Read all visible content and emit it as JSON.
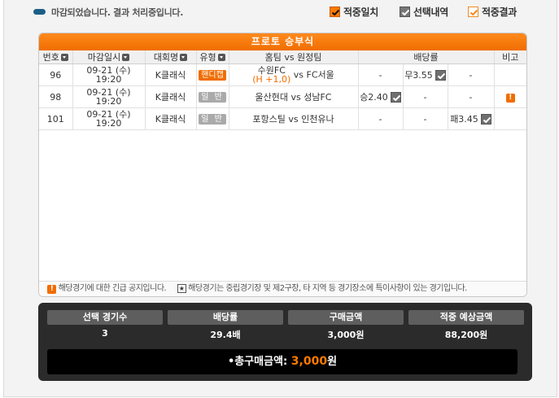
{
  "header": {
    "status_text": "마감되었습니다. 결과 처리중입니다.",
    "legend": [
      {
        "label": "적중일치",
        "style": "orange-check"
      },
      {
        "label": "선택내역",
        "style": "gray-check"
      },
      {
        "label": "적중결과",
        "style": "orange-outline-check"
      }
    ]
  },
  "panel": {
    "title": "프로토 승부식",
    "columns": {
      "no": "번호",
      "deadline": "마감일시",
      "league": "대회명",
      "type": "유형",
      "match": "홈팀 vs 원정팀",
      "odds": "배당률",
      "note": "비고"
    },
    "rows": [
      {
        "no": "96",
        "date": "09-21 (수)",
        "time": "19:20",
        "league": "K클래식",
        "type": "핸디캡",
        "home": "수원FC",
        "handicap": "(H +1,0)",
        "vs": "vs",
        "away": "FC서울",
        "odds_win": "-",
        "odds_draw": "무3.55",
        "odds_lose": "-",
        "selected": "draw",
        "note": ""
      },
      {
        "no": "98",
        "date": "09-21 (수)",
        "time": "19:20",
        "league": "K클래식",
        "type": "일 반",
        "home": "울산현대",
        "handicap": "",
        "vs": "vs",
        "away": "성남FC",
        "odds_win": "승2.40",
        "odds_draw": "-",
        "odds_lose": "-",
        "selected": "win",
        "note": "!"
      },
      {
        "no": "101",
        "date": "09-21 (수)",
        "time": "19:20",
        "league": "K클래식",
        "type": "일 반",
        "home": "포항스틸",
        "handicap": "",
        "vs": "vs",
        "away": "인천유나",
        "odds_win": "-",
        "odds_draw": "-",
        "odds_lose": "패3.45",
        "selected": "lose",
        "note": ""
      }
    ],
    "notice_1": "해당경기에 대한 긴급 공지입니다.",
    "notice_2": "해당경기는 중립경기장 및 제2구장, 타 지역 등 경기장소에 특이사항이 있는 경기입니다."
  },
  "summary": {
    "headers": [
      "선택 경기수",
      "배당률",
      "구매금액",
      "적중 예상금액"
    ],
    "values": [
      "3",
      "29.4배",
      "3,000원",
      "88,200원"
    ],
    "total_label": "총구매금액:",
    "total_amount": "3,000",
    "total_unit": "원"
  },
  "colors": {
    "accent": "#f06d00",
    "summary_bg": "#2b2b2b"
  }
}
